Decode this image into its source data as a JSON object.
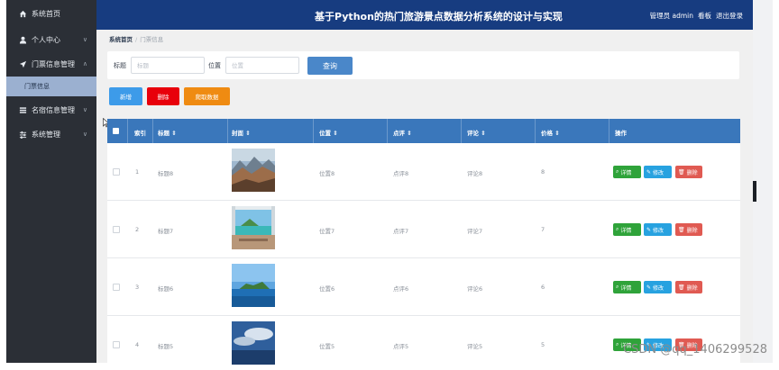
{
  "app": {
    "title": "基于Python的热门旅游景点数据分析系统的设计与实现",
    "header_right": [
      "管理员 admin",
      "看板",
      "退出登录"
    ]
  },
  "sidebar": {
    "items": [
      {
        "label": "系统首页",
        "icon": "home-icon"
      },
      {
        "label": "个人中心",
        "icon": "user-icon",
        "expandable": true
      },
      {
        "label": "门票信息管理",
        "icon": "send-icon",
        "expandable": true,
        "expanded": true
      },
      {
        "label": "门票信息",
        "sub": true
      },
      {
        "label": "名宿信息管理",
        "icon": "list-icon",
        "expandable": true
      },
      {
        "label": "系统管理",
        "icon": "sliders-icon",
        "expandable": true
      }
    ]
  },
  "breadcrumb": {
    "home": "系统首页",
    "current": "门票信息"
  },
  "search": {
    "title_label": "标题",
    "title_placeholder": "标题",
    "location_label": "位置",
    "location_placeholder": "位置",
    "query_button": "查询"
  },
  "actions": {
    "add": "新增",
    "delete": "删除",
    "fetch": "爬取数据"
  },
  "actions_colors": {
    "add": "#3d9be9",
    "delete": "#e8000b",
    "fetch": "#ef8b12"
  },
  "table": {
    "headers": [
      "索引",
      "标题 ⇕",
      "封面 ⇕",
      "位置 ⇕",
      "点评 ⇕",
      "评论 ⇕",
      "价格 ⇕",
      "操作"
    ],
    "row_actions": {
      "detail": "详情",
      "edit": "修改",
      "delete": "删除"
    },
    "rows": [
      {
        "index": "1",
        "title": "标题8",
        "location": "位置8",
        "review": "点评8",
        "comment": "评论8",
        "price": "8",
        "cover": "mountain-lake"
      },
      {
        "index": "2",
        "title": "标题7",
        "location": "位置7",
        "review": "点评7",
        "comment": "评论7",
        "price": "7",
        "cover": "beach-window"
      },
      {
        "index": "3",
        "title": "标题6",
        "location": "位置6",
        "review": "点评6",
        "comment": "评论6",
        "price": "6",
        "cover": "island-sea"
      },
      {
        "index": "4",
        "title": "标题5",
        "location": "位置5",
        "review": "点评5",
        "comment": "评论5",
        "price": "5",
        "cover": "sky-sea"
      }
    ]
  },
  "watermark": "CSDN @qq_1406299528",
  "colors": {
    "header": "#173c80",
    "sidebar": "#2b2f36",
    "table_header": "#3a77bb",
    "query": "#4a87c9"
  }
}
